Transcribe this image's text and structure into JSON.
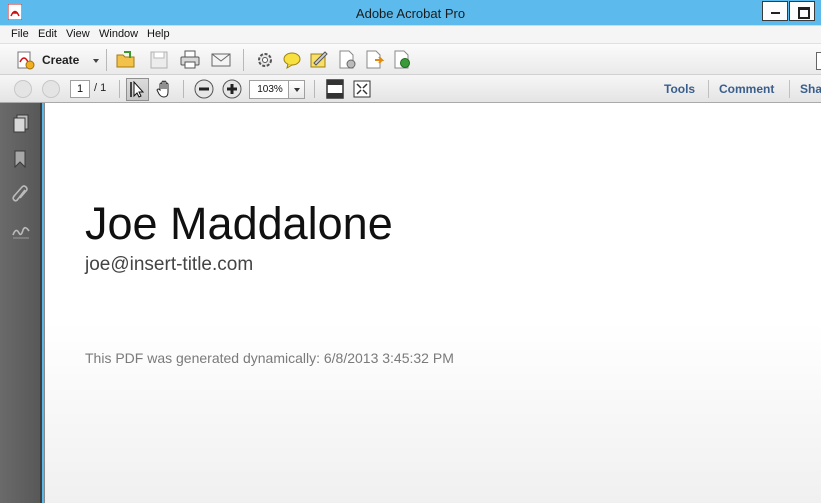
{
  "window": {
    "title": "Adobe Acrobat Pro"
  },
  "menu": [
    "File",
    "Edit",
    "View",
    "Window",
    "Help"
  ],
  "toolbar": {
    "create_label": "Create"
  },
  "navigation": {
    "current_page": "1",
    "total_pages": "/ 1",
    "zoom": "103%"
  },
  "tabs": [
    "Tools",
    "Comment",
    "Sha"
  ],
  "document": {
    "name": "Joe Maddalone",
    "email": "joe@insert-title.com",
    "note": "This PDF was generated dynamically: 6/8/2013 3:45:32 PM"
  },
  "colors": {
    "titlebar": "#5cbbec",
    "leftnav": "#5e5e5e",
    "tab_text": "#3a5e8c"
  },
  "icons": [
    "acrobat-logo-icon",
    "create-icon",
    "open-folder-icon",
    "save-icon",
    "print-icon",
    "email-icon",
    "settings-icon",
    "comment-icon",
    "sign-icon",
    "secure-icon",
    "share-icon",
    "export-icon",
    "page-up-icon",
    "page-down-icon",
    "select-tool-icon",
    "hand-tool-icon",
    "zoom-out-icon",
    "zoom-in-icon",
    "fit-page-icon",
    "full-screen-icon",
    "pages-panel-icon",
    "bookmarks-panel-icon",
    "attachments-panel-icon",
    "signatures-panel-icon"
  ]
}
